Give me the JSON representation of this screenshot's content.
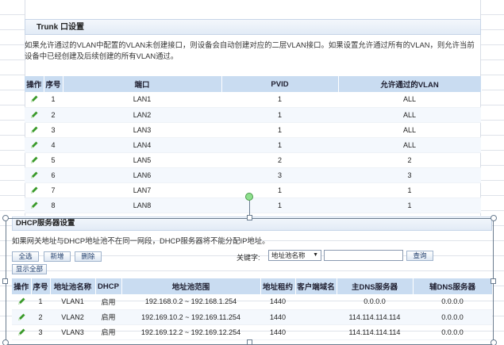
{
  "trunk": {
    "title": "Trunk 口设置",
    "description": "如果允许通过的VLAN中配置的VLAN未创建接口，则设备会自动创建对应的二层VLAN接口。如果设置允许通过所有的VLAN，则允许当前设备中已经创建及后续创建的所有VLAN通过。",
    "columns": [
      "操作",
      "序号",
      "端口",
      "PVID",
      "允许通过的VLAN"
    ],
    "rows": [
      {
        "no": "1",
        "port": "LAN1",
        "pvid": "1",
        "vlan": "ALL"
      },
      {
        "no": "2",
        "port": "LAN2",
        "pvid": "1",
        "vlan": "ALL"
      },
      {
        "no": "3",
        "port": "LAN3",
        "pvid": "1",
        "vlan": "ALL"
      },
      {
        "no": "4",
        "port": "LAN4",
        "pvid": "1",
        "vlan": "ALL"
      },
      {
        "no": "5",
        "port": "LAN5",
        "pvid": "2",
        "vlan": "2"
      },
      {
        "no": "6",
        "port": "LAN6",
        "pvid": "3",
        "vlan": "3"
      },
      {
        "no": "7",
        "port": "LAN7",
        "pvid": "1",
        "vlan": "1"
      },
      {
        "no": "8",
        "port": "LAN8",
        "pvid": "1",
        "vlan": "1"
      }
    ]
  },
  "dhcp": {
    "title": "DHCP服务器设置",
    "description": "如果网关地址与DHCP地址池不在同一网段，DHCP服务器将不能分配IP地址。",
    "buttons": {
      "select_all": "全选",
      "add": "新增",
      "delete": "删除",
      "show_all": "显示全部",
      "search": "查询"
    },
    "keyword_label": "关键字:",
    "keyword_select": "地址池名称",
    "keyword_value": "",
    "columns": [
      "操作",
      "序号",
      "地址池名称",
      "DHCP",
      "地址池范围",
      "地址租约",
      "客户端域名",
      "主DNS服务器",
      "辅DNS服务器"
    ],
    "rows": [
      {
        "no": "1",
        "name": "VLAN1",
        "dhcp": "启用",
        "range": "192.168.0.2 ~ 192.168.1.254",
        "lease": "1440",
        "domain": "",
        "dns1": "0.0.0.0",
        "dns2": "0.0.0.0"
      },
      {
        "no": "2",
        "name": "VLAN2",
        "dhcp": "启用",
        "range": "192.169.10.2 ~ 192.169.11.254",
        "lease": "1440",
        "domain": "",
        "dns1": "114.114.114.114",
        "dns2": "0.0.0.0"
      },
      {
        "no": "3",
        "name": "VLAN3",
        "dhcp": "启用",
        "range": "192.169.12.2 ~ 192.169.12.254",
        "lease": "1440",
        "domain": "",
        "dns1": "114.114.114.114",
        "dns2": "0.0.0.0"
      }
    ]
  },
  "colors": {
    "header_bg": "#c9dcf1",
    "edit_icon": "#3a9a2a",
    "selection_border": "#6b7c8f"
  }
}
